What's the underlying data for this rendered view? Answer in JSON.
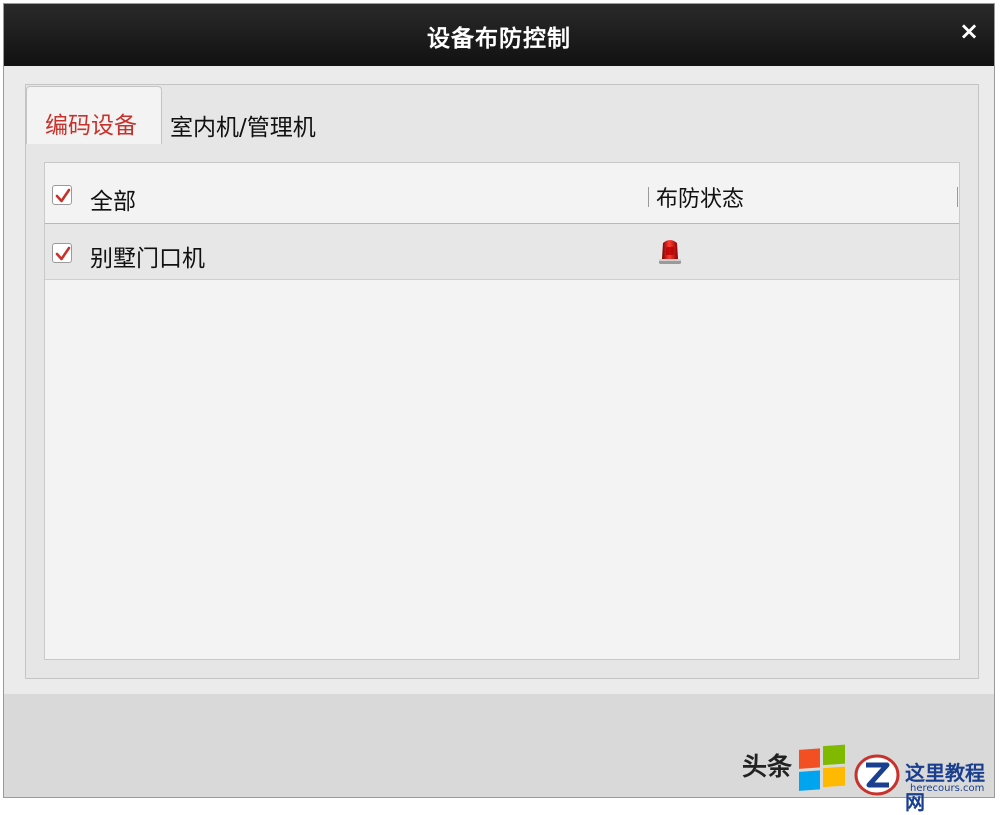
{
  "dialog": {
    "title": "设备布防控制",
    "close_glyph": "×"
  },
  "tabs": [
    {
      "label": "编码设备",
      "active": true
    },
    {
      "label": "室内机/管理机",
      "active": false
    }
  ],
  "table": {
    "header": {
      "select_all_label": "全部",
      "select_all_checked": true,
      "status_column": "布防状态"
    },
    "rows": [
      {
        "name": "别墅门口机",
        "checked": true,
        "status_icon": "alarm-siren-icon"
      }
    ]
  },
  "watermark": {
    "text": "头条",
    "site_name": "这里教程网",
    "site_url": "herecours.com"
  },
  "colors": {
    "active_tab": "#c8322c",
    "checkmark": "#c8322c",
    "titlebar": "#1c1c1c"
  }
}
